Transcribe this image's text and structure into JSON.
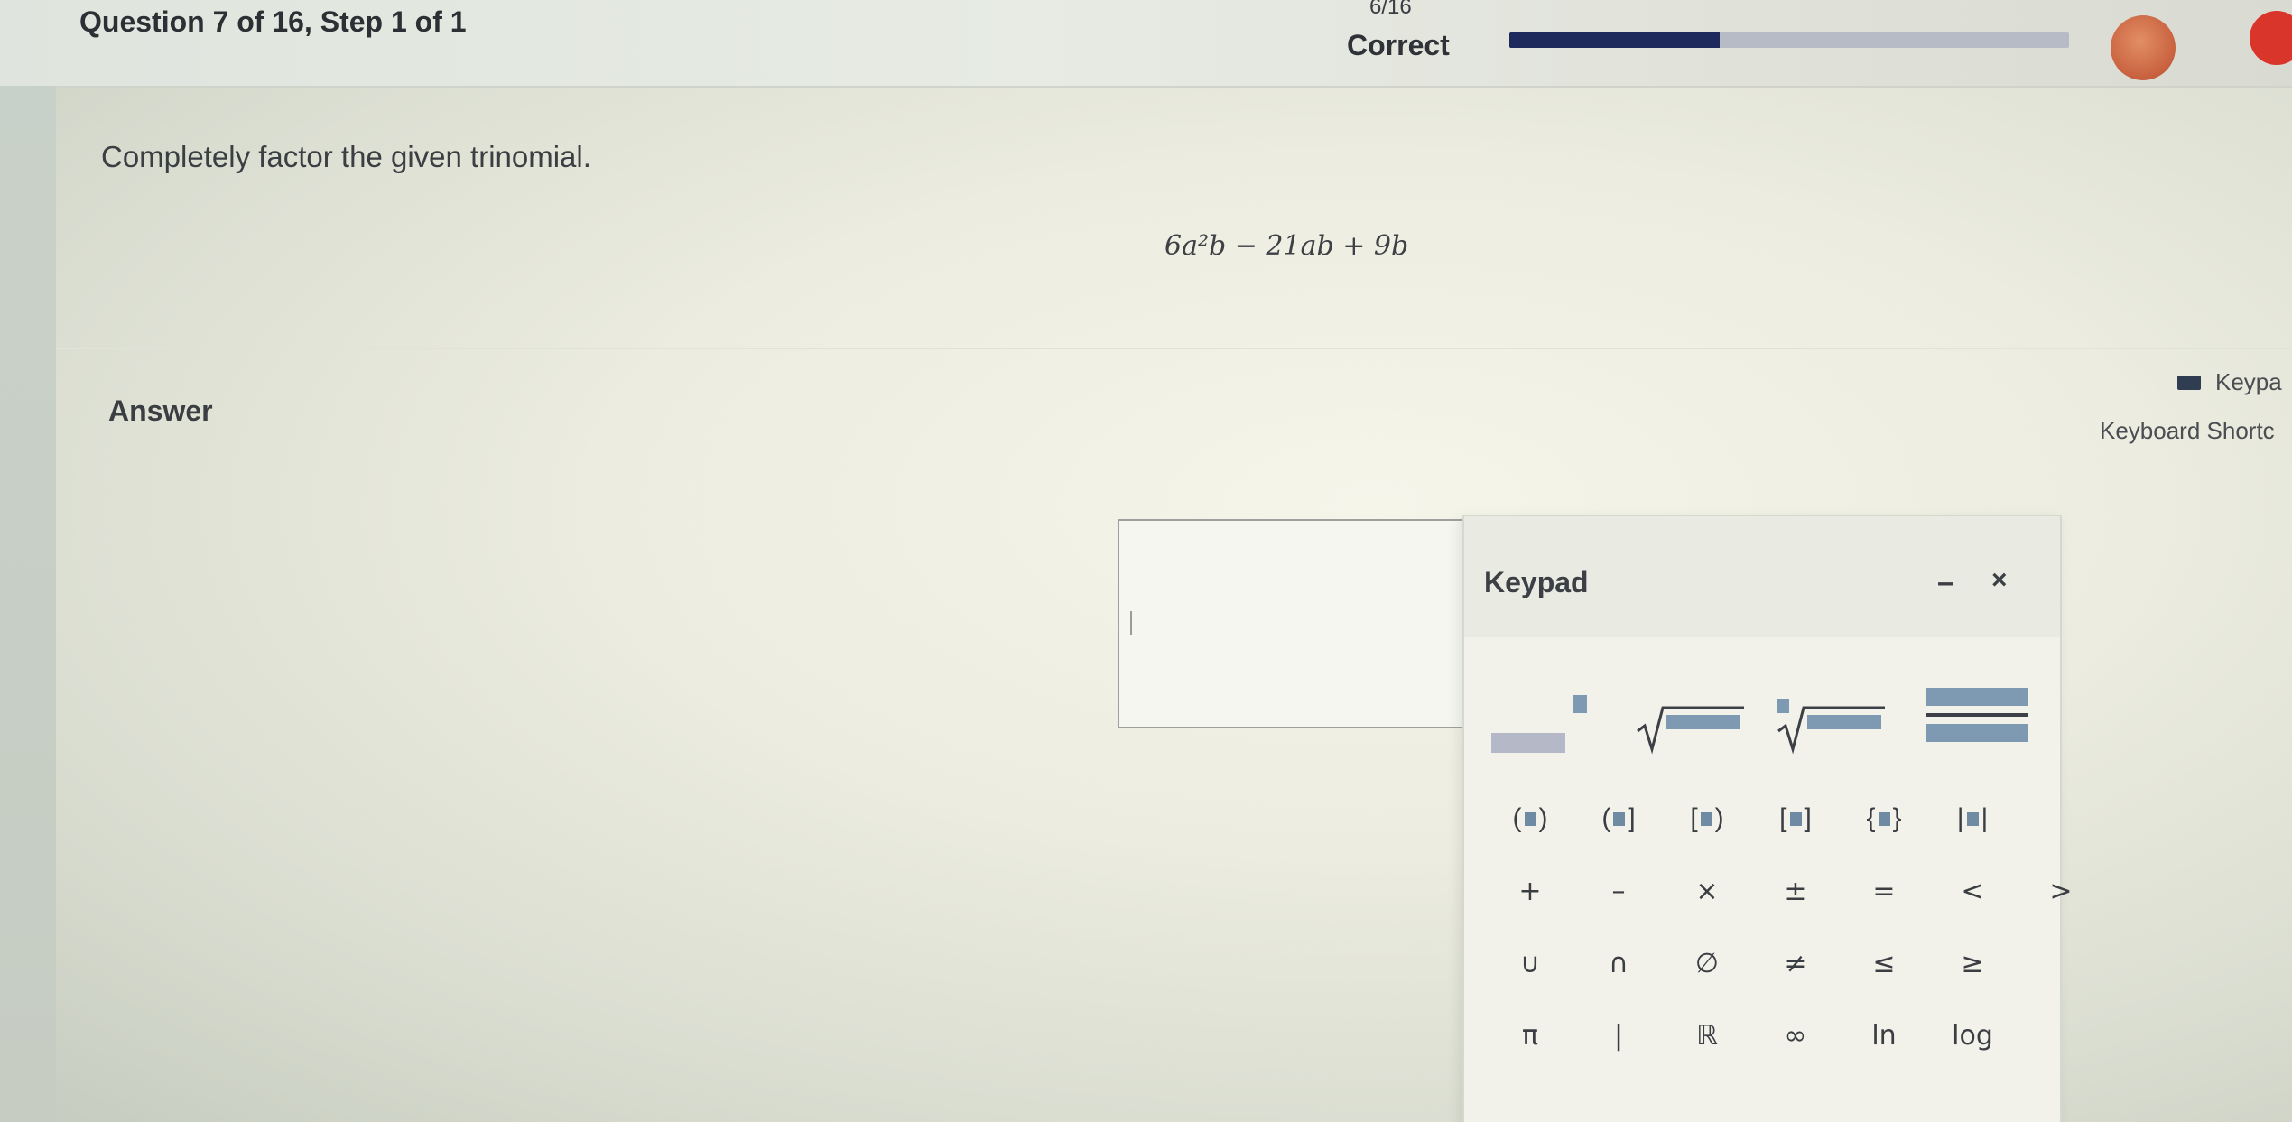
{
  "header": {
    "question_title": "Question 7 of 16, Step 1 of 1",
    "score": "6/16",
    "status": "Correct",
    "progress_fraction": 0.375,
    "colors": {
      "progress_fill": "#1f2a5c",
      "progress_track": "#b7bbc6",
      "notification": "#d9352a"
    }
  },
  "question": {
    "prompt": "Completely factor the given trinomial.",
    "expression": "6a²b − 21ab + 9b"
  },
  "answer": {
    "label": "Answer",
    "keypad_toggle": "Keypa",
    "shortcuts_link": "Keyboard Shortc",
    "value": ""
  },
  "keypad": {
    "title": "Keypad",
    "minimize": "–",
    "close": "×",
    "templates": [
      "exponent",
      "square-root",
      "nth-root",
      "fraction"
    ],
    "brackets": [
      "(■)",
      "(■]",
      "[■)",
      "[■]",
      "{■}",
      "|■|"
    ],
    "operators": [
      "+",
      "–",
      "×",
      "±",
      "=",
      "<",
      ">"
    ],
    "sets": [
      "∪",
      "∩",
      "∅",
      "≠",
      "≤",
      "≥"
    ],
    "misc": [
      "π",
      "|",
      "ℝ",
      "∞",
      "ln",
      "log"
    ]
  }
}
